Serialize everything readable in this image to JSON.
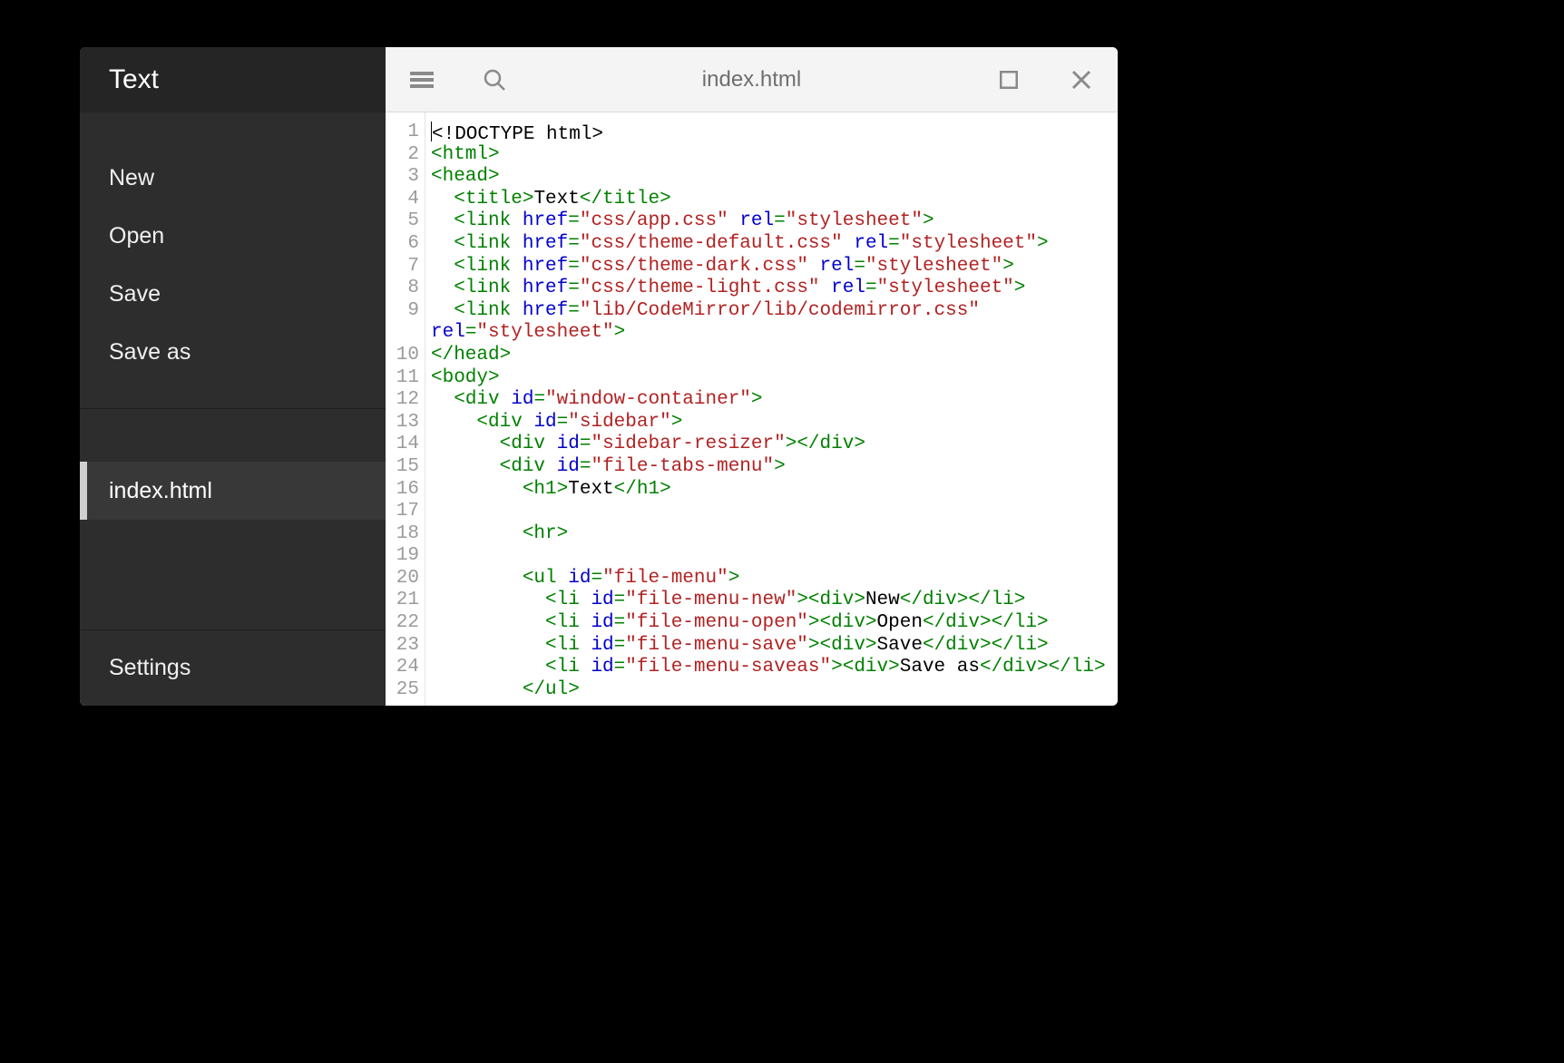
{
  "sidebar": {
    "title": "Text",
    "menu": [
      "New",
      "Open",
      "Save",
      "Save as"
    ],
    "tabs": [
      "index.html"
    ],
    "settings": "Settings"
  },
  "toolbar": {
    "filename": "index.html"
  },
  "editor": {
    "line_count": 25,
    "lines": [
      {
        "n": 1,
        "segs": [
          {
            "c": "text",
            "t": "<!DOCTYPE html>"
          }
        ]
      },
      {
        "n": 2,
        "segs": [
          {
            "c": "tag",
            "t": "<html>"
          }
        ]
      },
      {
        "n": 3,
        "segs": [
          {
            "c": "tag",
            "t": "<head>"
          }
        ]
      },
      {
        "n": 4,
        "segs": [
          {
            "c": "text",
            "t": "  "
          },
          {
            "c": "tag",
            "t": "<title>"
          },
          {
            "c": "text",
            "t": "Text"
          },
          {
            "c": "tag",
            "t": "</title>"
          }
        ]
      },
      {
        "n": 5,
        "segs": [
          {
            "c": "text",
            "t": "  "
          },
          {
            "c": "tag",
            "t": "<link "
          },
          {
            "c": "attr",
            "t": "href"
          },
          {
            "c": "tag",
            "t": "="
          },
          {
            "c": "str",
            "t": "\"css/app.css\""
          },
          {
            "c": "tag",
            "t": " "
          },
          {
            "c": "attr",
            "t": "rel"
          },
          {
            "c": "tag",
            "t": "="
          },
          {
            "c": "str",
            "t": "\"stylesheet\""
          },
          {
            "c": "tag",
            "t": ">"
          }
        ]
      },
      {
        "n": 6,
        "segs": [
          {
            "c": "text",
            "t": "  "
          },
          {
            "c": "tag",
            "t": "<link "
          },
          {
            "c": "attr",
            "t": "href"
          },
          {
            "c": "tag",
            "t": "="
          },
          {
            "c": "str",
            "t": "\"css/theme-default.css\""
          },
          {
            "c": "tag",
            "t": " "
          },
          {
            "c": "attr",
            "t": "rel"
          },
          {
            "c": "tag",
            "t": "="
          },
          {
            "c": "str",
            "t": "\"stylesheet\""
          },
          {
            "c": "tag",
            "t": ">"
          }
        ]
      },
      {
        "n": 7,
        "segs": [
          {
            "c": "text",
            "t": "  "
          },
          {
            "c": "tag",
            "t": "<link "
          },
          {
            "c": "attr",
            "t": "href"
          },
          {
            "c": "tag",
            "t": "="
          },
          {
            "c": "str",
            "t": "\"css/theme-dark.css\""
          },
          {
            "c": "tag",
            "t": " "
          },
          {
            "c": "attr",
            "t": "rel"
          },
          {
            "c": "tag",
            "t": "="
          },
          {
            "c": "str",
            "t": "\"stylesheet\""
          },
          {
            "c": "tag",
            "t": ">"
          }
        ]
      },
      {
        "n": 8,
        "segs": [
          {
            "c": "text",
            "t": "  "
          },
          {
            "c": "tag",
            "t": "<link "
          },
          {
            "c": "attr",
            "t": "href"
          },
          {
            "c": "tag",
            "t": "="
          },
          {
            "c": "str",
            "t": "\"css/theme-light.css\""
          },
          {
            "c": "tag",
            "t": " "
          },
          {
            "c": "attr",
            "t": "rel"
          },
          {
            "c": "tag",
            "t": "="
          },
          {
            "c": "str",
            "t": "\"stylesheet\""
          },
          {
            "c": "tag",
            "t": ">"
          }
        ]
      },
      {
        "n": 9,
        "segs": [
          {
            "c": "text",
            "t": "  "
          },
          {
            "c": "tag",
            "t": "<link "
          },
          {
            "c": "attr",
            "t": "href"
          },
          {
            "c": "tag",
            "t": "="
          },
          {
            "c": "str",
            "t": "\"lib/CodeMirror/lib/codemirror.css\""
          }
        ]
      },
      {
        "n": 9,
        "cont": true,
        "segs": [
          {
            "c": "attr",
            "t": "rel"
          },
          {
            "c": "tag",
            "t": "="
          },
          {
            "c": "str",
            "t": "\"stylesheet\""
          },
          {
            "c": "tag",
            "t": ">"
          }
        ]
      },
      {
        "n": 10,
        "segs": [
          {
            "c": "tag",
            "t": "</head>"
          }
        ]
      },
      {
        "n": 11,
        "segs": [
          {
            "c": "tag",
            "t": "<body>"
          }
        ]
      },
      {
        "n": 12,
        "segs": [
          {
            "c": "text",
            "t": "  "
          },
          {
            "c": "tag",
            "t": "<div "
          },
          {
            "c": "attr",
            "t": "id"
          },
          {
            "c": "tag",
            "t": "="
          },
          {
            "c": "str",
            "t": "\"window-container\""
          },
          {
            "c": "tag",
            "t": ">"
          }
        ]
      },
      {
        "n": 13,
        "segs": [
          {
            "c": "text",
            "t": "    "
          },
          {
            "c": "tag",
            "t": "<div "
          },
          {
            "c": "attr",
            "t": "id"
          },
          {
            "c": "tag",
            "t": "="
          },
          {
            "c": "str",
            "t": "\"sidebar\""
          },
          {
            "c": "tag",
            "t": ">"
          }
        ]
      },
      {
        "n": 14,
        "segs": [
          {
            "c": "text",
            "t": "      "
          },
          {
            "c": "tag",
            "t": "<div "
          },
          {
            "c": "attr",
            "t": "id"
          },
          {
            "c": "tag",
            "t": "="
          },
          {
            "c": "str",
            "t": "\"sidebar-resizer\""
          },
          {
            "c": "tag",
            "t": "></div>"
          }
        ]
      },
      {
        "n": 15,
        "segs": [
          {
            "c": "text",
            "t": "      "
          },
          {
            "c": "tag",
            "t": "<div "
          },
          {
            "c": "attr",
            "t": "id"
          },
          {
            "c": "tag",
            "t": "="
          },
          {
            "c": "str",
            "t": "\"file-tabs-menu\""
          },
          {
            "c": "tag",
            "t": ">"
          }
        ]
      },
      {
        "n": 16,
        "segs": [
          {
            "c": "text",
            "t": "        "
          },
          {
            "c": "tag",
            "t": "<h1>"
          },
          {
            "c": "text",
            "t": "Text"
          },
          {
            "c": "tag",
            "t": "</h1>"
          }
        ]
      },
      {
        "n": 17,
        "segs": []
      },
      {
        "n": 18,
        "segs": [
          {
            "c": "text",
            "t": "        "
          },
          {
            "c": "tag",
            "t": "<hr>"
          }
        ]
      },
      {
        "n": 19,
        "segs": []
      },
      {
        "n": 20,
        "segs": [
          {
            "c": "text",
            "t": "        "
          },
          {
            "c": "tag",
            "t": "<ul "
          },
          {
            "c": "attr",
            "t": "id"
          },
          {
            "c": "tag",
            "t": "="
          },
          {
            "c": "str",
            "t": "\"file-menu\""
          },
          {
            "c": "tag",
            "t": ">"
          }
        ]
      },
      {
        "n": 21,
        "segs": [
          {
            "c": "text",
            "t": "          "
          },
          {
            "c": "tag",
            "t": "<li "
          },
          {
            "c": "attr",
            "t": "id"
          },
          {
            "c": "tag",
            "t": "="
          },
          {
            "c": "str",
            "t": "\"file-menu-new\""
          },
          {
            "c": "tag",
            "t": "><div>"
          },
          {
            "c": "text",
            "t": "New"
          },
          {
            "c": "tag",
            "t": "</div></li>"
          }
        ]
      },
      {
        "n": 22,
        "segs": [
          {
            "c": "text",
            "t": "          "
          },
          {
            "c": "tag",
            "t": "<li "
          },
          {
            "c": "attr",
            "t": "id"
          },
          {
            "c": "tag",
            "t": "="
          },
          {
            "c": "str",
            "t": "\"file-menu-open\""
          },
          {
            "c": "tag",
            "t": "><div>"
          },
          {
            "c": "text",
            "t": "Open"
          },
          {
            "c": "tag",
            "t": "</div></li>"
          }
        ]
      },
      {
        "n": 23,
        "segs": [
          {
            "c": "text",
            "t": "          "
          },
          {
            "c": "tag",
            "t": "<li "
          },
          {
            "c": "attr",
            "t": "id"
          },
          {
            "c": "tag",
            "t": "="
          },
          {
            "c": "str",
            "t": "\"file-menu-save\""
          },
          {
            "c": "tag",
            "t": "><div>"
          },
          {
            "c": "text",
            "t": "Save"
          },
          {
            "c": "tag",
            "t": "</div></li>"
          }
        ]
      },
      {
        "n": 24,
        "segs": [
          {
            "c": "text",
            "t": "          "
          },
          {
            "c": "tag",
            "t": "<li "
          },
          {
            "c": "attr",
            "t": "id"
          },
          {
            "c": "tag",
            "t": "="
          },
          {
            "c": "str",
            "t": "\"file-menu-saveas\""
          },
          {
            "c": "tag",
            "t": "><div>"
          },
          {
            "c": "text",
            "t": "Save as"
          },
          {
            "c": "tag",
            "t": "</div></li>"
          }
        ]
      },
      {
        "n": 25,
        "segs": [
          {
            "c": "text",
            "t": "        "
          },
          {
            "c": "tag",
            "t": "</ul>"
          }
        ]
      }
    ]
  }
}
